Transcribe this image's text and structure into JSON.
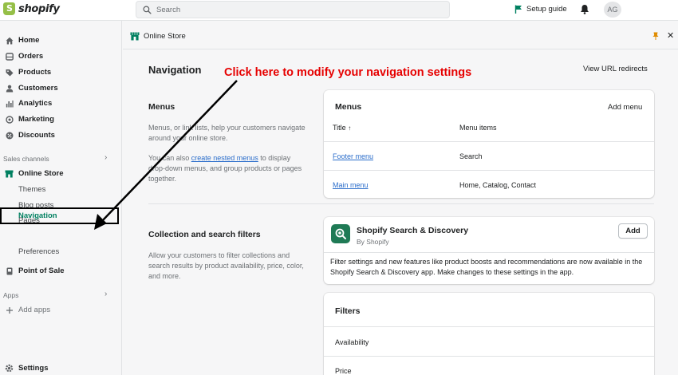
{
  "app": {
    "logo_text": "shopify"
  },
  "search": {
    "placeholder": "Search"
  },
  "topbar": {
    "setup_guide": "Setup guide",
    "avatar_initials": "AG"
  },
  "sidebar": {
    "items": [
      {
        "label": "Home",
        "icon": "home-icon"
      },
      {
        "label": "Orders",
        "icon": "orders-icon"
      },
      {
        "label": "Products",
        "icon": "tag-icon"
      },
      {
        "label": "Customers",
        "icon": "person-icon"
      },
      {
        "label": "Analytics",
        "icon": "bar-chart-icon"
      },
      {
        "label": "Marketing",
        "icon": "target-icon"
      },
      {
        "label": "Discounts",
        "icon": "discount-icon"
      }
    ],
    "sales_channels_label": "Sales channels",
    "online_store": "Online Store",
    "online_store_sub": [
      "Themes",
      "Blog posts",
      "Pages",
      "Navigation",
      "Preferences"
    ],
    "point_of_sale": "Point of Sale",
    "apps_label": "Apps",
    "add_apps": "Add apps",
    "settings": "Settings"
  },
  "header": {
    "breadcrumb": "Online Store"
  },
  "page": {
    "title": "Navigation",
    "view_url_redirects": "View URL redirects",
    "annotation": "Click here to modify your navigation settings"
  },
  "menus_section": {
    "title": "Menus",
    "desc_1": "Menus, or link lists, help your customers navigate around your online store.",
    "desc_2_pre": "You can also ",
    "desc_2_link": "create nested menus",
    "desc_2_post": " to display drop-down menus, and group products or pages together."
  },
  "menus_card": {
    "title": "Menus",
    "add_menu": "Add menu",
    "col_title": "Title",
    "sort_icon": "↑",
    "col_items": "Menu items",
    "rows": [
      {
        "title": "Footer menu",
        "items": "Search"
      },
      {
        "title": "Main menu",
        "items": "Home, Catalog, Contact"
      }
    ]
  },
  "filters_section": {
    "title": "Collection and search filters",
    "desc": "Allow your customers to filter collections and search results by product availability, price, color, and more."
  },
  "discovery_card": {
    "title": "Shopify Search & Discovery",
    "subtitle": "By Shopify",
    "add_label": "Add",
    "desc": "Filter settings and new features like product boosts and recommendations are now available in the Shopify Search & Discovery app. Make changes to these settings in the app."
  },
  "filters_card": {
    "title": "Filters",
    "items": [
      "Availability",
      "Price"
    ]
  },
  "colors": {
    "accent": "#008060",
    "link": "#2c6ecb",
    "annotation": "#e60000"
  }
}
